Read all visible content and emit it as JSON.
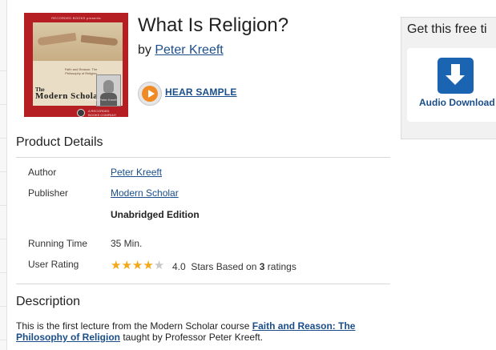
{
  "cover": {
    "brand": "RECORDED BOOKS presents",
    "series_small": "The",
    "series_large": "Modern Scholar",
    "course_title": "Faith and Reason: The Philosophy of Religion",
    "professor": "Professor Peter Kreeft",
    "publisher": "A RECORDED BOOKS COMPANY"
  },
  "book": {
    "title": "What Is Religion?",
    "by": "by",
    "author": "Peter Kreeft"
  },
  "sample": {
    "label": "HEAR SAMPLE"
  },
  "details": {
    "heading": "Product Details",
    "author_label": "Author",
    "author_value": "Peter Kreeft",
    "publisher_label": "Publisher",
    "publisher_value": "Modern Scholar",
    "edition": "Unabridged Edition",
    "running_time_label": "Running Time",
    "running_time_value": "35 Min.",
    "user_rating_label": "User Rating",
    "rating_value": "4.0",
    "rating_text_before": "Stars Based on",
    "rating_count": "3",
    "rating_text_after": "ratings",
    "stars_filled": 4,
    "stars_total": 5
  },
  "description": {
    "heading": "Description",
    "text_before": "This is the first lecture from the Modern Scholar course ",
    "course_link": "Faith and Reason: The Philosophy of Religion",
    "text_after": " taught by Professor Peter Kreeft."
  },
  "sidebar": {
    "heading": "Get this free ti",
    "download_label": "Audio Download"
  },
  "colors": {
    "link": "#1a4e8a",
    "star": "#f3a81b",
    "play": "#f08a24",
    "download": "#1b64b2",
    "cover_red": "#b51f24"
  }
}
